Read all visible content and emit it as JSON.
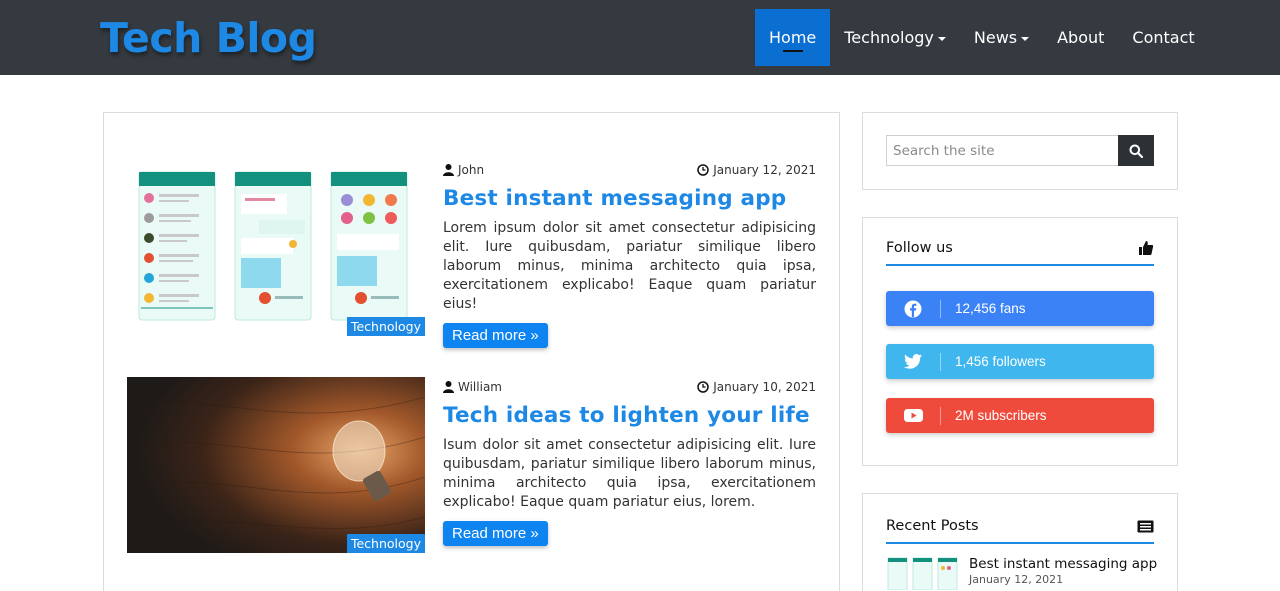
{
  "header": {
    "brand": "Tech Blog",
    "nav": [
      {
        "label": "Home",
        "active": true,
        "dropdown": false
      },
      {
        "label": "Technology",
        "active": false,
        "dropdown": true
      },
      {
        "label": "News",
        "active": false,
        "dropdown": true
      },
      {
        "label": "About",
        "active": false,
        "dropdown": false
      },
      {
        "label": "Contact",
        "active": false,
        "dropdown": false
      }
    ]
  },
  "posts": [
    {
      "author": "John",
      "date": "January 12, 2021",
      "title": "Best instant messaging app",
      "excerpt": "Lorem ipsum dolor sit amet consectetur adipisicing elit. Iure quibusdam, pariatur similique libero laborum minus, minima architecto quia ipsa, exercitationem explicabo! Eaque quam pariatur eius!",
      "category": "Technology",
      "read_more": "Read more »",
      "image": "messaging-app-screens"
    },
    {
      "author": "William",
      "date": "January 10, 2021",
      "title": "Tech ideas to lighten your life",
      "excerpt": "Isum dolor sit amet consectetur adipisicing elit. Iure quibusdam, pariatur similique libero laborum minus, minima architecto quia ipsa, exercitationem explicabo! Eaque quam pariatur eius, lorem.",
      "category": "Technology",
      "read_more": "Read more »",
      "image": "light-bulb-on-wood"
    }
  ],
  "sidebar": {
    "search": {
      "placeholder": "Search the site",
      "icon": "search-icon"
    },
    "follow": {
      "title": "Follow us",
      "icon": "thumbs-up-icon",
      "items": [
        {
          "network": "facebook",
          "text": "12,456 fans",
          "color": "#3b82f6"
        },
        {
          "network": "twitter",
          "text": "1,456 followers",
          "color": "#3fb6ee"
        },
        {
          "network": "youtube",
          "text": "2M subscribers",
          "color": "#ef4b3c"
        }
      ]
    },
    "recent": {
      "title": "Recent Posts",
      "icon": "newspaper-icon",
      "items": [
        {
          "title": "Best instant messaging app",
          "date": "January 12, 2021"
        }
      ]
    }
  },
  "colors": {
    "header_bg": "#343a40",
    "accent": "#1e88e5",
    "active_nav": "#0a6fd1"
  }
}
